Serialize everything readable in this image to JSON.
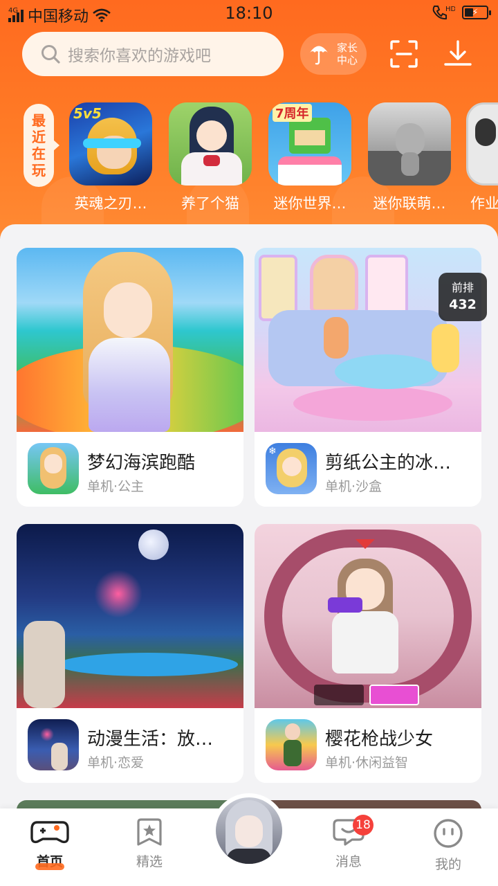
{
  "status_bar": {
    "net": "4G",
    "carrier": "中国移动",
    "time": "18:10",
    "call_label": "HD",
    "battery_level": 0.35
  },
  "header": {
    "search_placeholder": "搜索你喜欢的游戏吧",
    "parent_center_label": "家长中心",
    "icons": [
      "search-icon",
      "umbrella-icon",
      "scan-icon",
      "download-icon"
    ]
  },
  "recent": {
    "tag": "最近在玩",
    "items": [
      {
        "name": "英魂之刃…",
        "icon_text": "5v5"
      },
      {
        "name": "养了个猫",
        "icon_text": ""
      },
      {
        "name": "迷你世界…",
        "icon_text": "7周年"
      },
      {
        "name": "迷你联萌…",
        "icon_text": ""
      },
      {
        "name": "作业",
        "icon_text": ""
      }
    ]
  },
  "rank_badge": {
    "line1": "前排",
    "line2": "432"
  },
  "games": [
    {
      "title": "梦幻海滨跑酷",
      "tags": "单机·公主"
    },
    {
      "title": "剪纸公主的冰…",
      "tags": "单机·沙盒"
    },
    {
      "title": "动漫生活：放…",
      "tags": "单机·恋爱"
    },
    {
      "title": "樱花枪战少女",
      "tags": "单机·休闲益智"
    }
  ],
  "nav": {
    "items": [
      {
        "label": "首页",
        "icon": "gamepad-icon",
        "active": true
      },
      {
        "label": "精选",
        "icon": "star-bookmark-icon",
        "active": false
      },
      {
        "label": "消息",
        "icon": "chat-bubble-icon",
        "active": false
      },
      {
        "label": "我的",
        "icon": "smiley-face-icon",
        "active": false
      }
    ],
    "message_badge": "18"
  },
  "colors": {
    "brand_orange": "#ff6a1f",
    "badge_red": "#f5413b"
  }
}
